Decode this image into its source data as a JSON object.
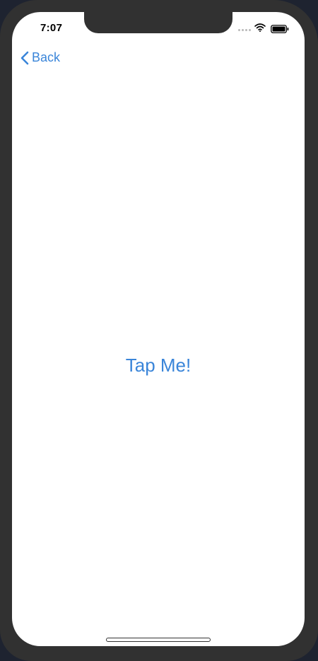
{
  "status_bar": {
    "time": "7:07"
  },
  "navigation": {
    "back_label": "Back"
  },
  "main": {
    "button_label": "Tap Me!"
  },
  "colors": {
    "accent": "#3a85d9",
    "bezel": "#313131",
    "screen": "#ffffff"
  },
  "icons": {
    "back": "chevron-left-icon",
    "wifi": "wifi-icon",
    "battery": "battery-icon",
    "signal": "cellular-signal-icon"
  }
}
